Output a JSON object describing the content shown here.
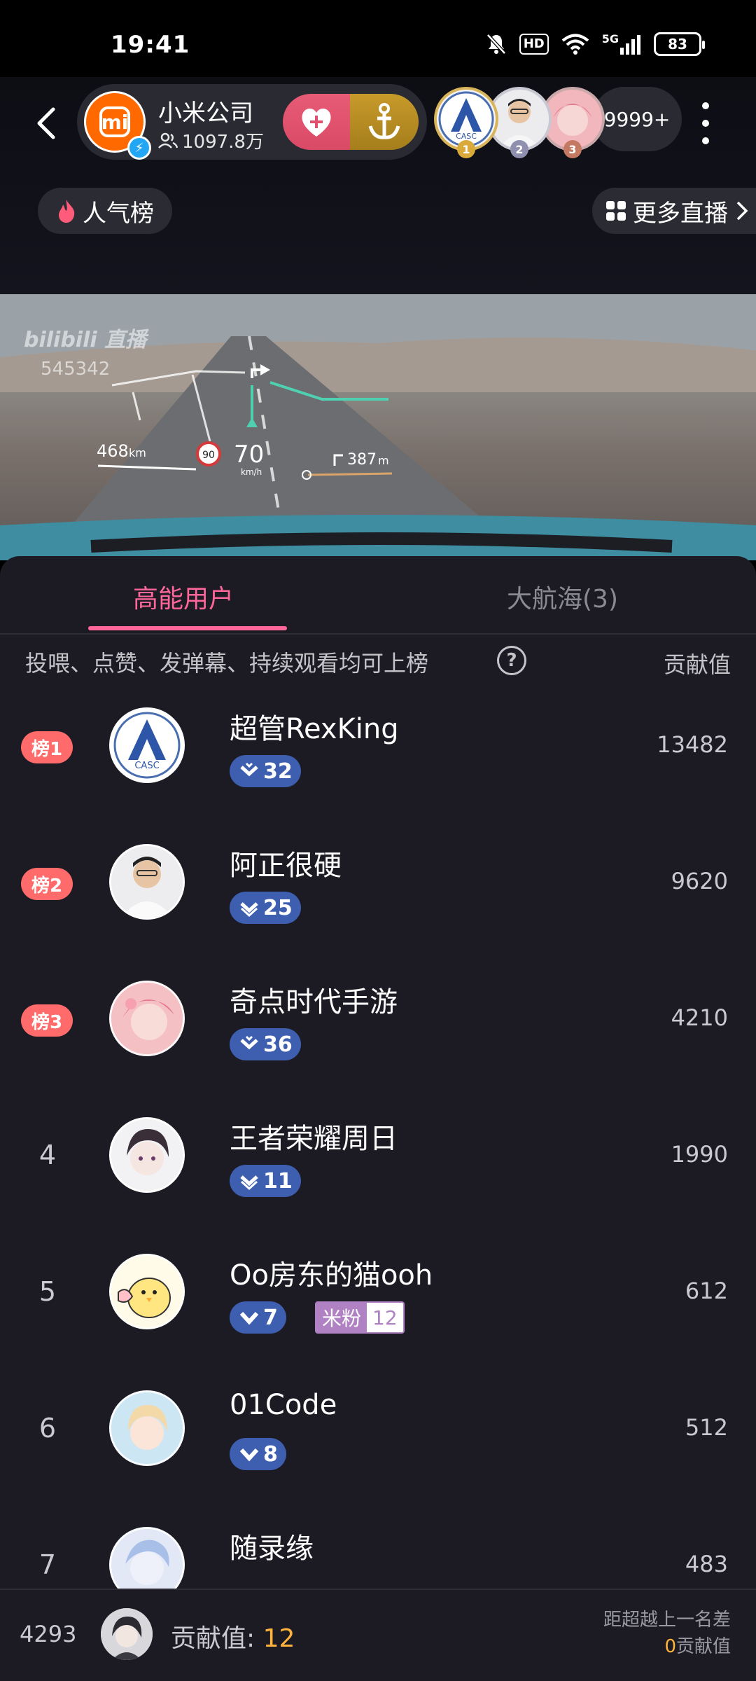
{
  "status_bar": {
    "time": "19:41",
    "hd_label": "HD",
    "network_label": "5G",
    "battery": "83"
  },
  "header": {
    "anchor_name": "小米公司",
    "anchor_fans": "1097.8万",
    "viewer_count": "9999+",
    "top_ranks": [
      "1",
      "2",
      "3"
    ],
    "hot_rank_label": "人气榜",
    "more_live_label": "更多直播"
  },
  "video": {
    "watermark": "bilibili 直播",
    "room_id": "545342",
    "hud": {
      "left_distance": "468",
      "left_unit": "km",
      "speed_limit": "90",
      "speed": "70",
      "speed_unit": "km/h",
      "turn_distance": "387",
      "turn_unit": "m"
    }
  },
  "panel": {
    "tabs": [
      {
        "label": "高能用户",
        "active": true
      },
      {
        "label": "大航海(3)",
        "active": false
      }
    ],
    "rule_text": "投喂、点赞、发弹幕、持续观看均可上榜",
    "help_glyph": "?",
    "contrib_header": "贡献值",
    "rows": [
      {
        "rank_label": "榜1",
        "name": "超管RexKing",
        "level": "32",
        "contribution": "13482"
      },
      {
        "rank_label": "榜2",
        "name": "阿正很硬",
        "level": "25",
        "contribution": "9620"
      },
      {
        "rank_label": "榜3",
        "name": "奇点时代手游",
        "level": "36",
        "contribution": "4210"
      },
      {
        "rank_label": "4",
        "name": "王者荣耀周日",
        "level": "11",
        "contribution": "1990"
      },
      {
        "rank_label": "5",
        "name": "Oo房东的猫ooh",
        "level": "7",
        "contribution": "612",
        "fan_badge": {
          "name": "米粉",
          "level": "12"
        }
      },
      {
        "rank_label": "6",
        "name": "01Code",
        "level": "8",
        "contribution": "512"
      },
      {
        "rank_label": "7",
        "name": "随录缘",
        "level": "",
        "contribution": "483"
      }
    ]
  },
  "bottom_bar": {
    "my_rank": "4293",
    "contrib_label": "贡献值: ",
    "contrib_value": "12",
    "gap_line1": "距超越上一名差",
    "gap_value": "0",
    "gap_unit": "贡献值"
  },
  "colors": {
    "accent_pink": "#ff6699",
    "rank_badge": "#ff6a6a",
    "level_badge": "#3e5eb0",
    "gold": "#ffb33d",
    "panel_bg": "#1c1b24"
  }
}
